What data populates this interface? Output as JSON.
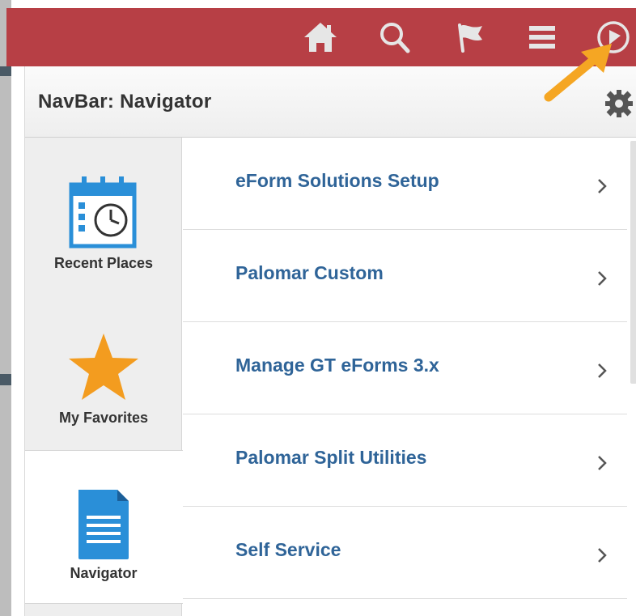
{
  "header": {
    "buttons": [
      {
        "name": "home-icon"
      },
      {
        "name": "search-icon"
      },
      {
        "name": "flag-icon"
      },
      {
        "name": "menu-icon"
      },
      {
        "name": "navbar-compass-icon"
      }
    ],
    "bar_color": "#b73f45"
  },
  "panel": {
    "title": "NavBar: Navigator",
    "settings_icon": "gear-icon"
  },
  "rail": {
    "items": [
      {
        "label": "Recent Places",
        "icon": "calendar-clock-icon",
        "active": false
      },
      {
        "label": "My Favorites",
        "icon": "star-icon",
        "active": false
      },
      {
        "label": "Navigator",
        "icon": "document-icon",
        "active": true
      }
    ]
  },
  "menu": {
    "items": [
      {
        "label": "eForm Solutions Setup"
      },
      {
        "label": "Palomar Custom"
      },
      {
        "label": "Manage GT eForms 3.x"
      },
      {
        "label": "Palomar Split Utilities"
      },
      {
        "label": "Self Service"
      }
    ],
    "chevron_icon": "chevron-right-icon"
  },
  "colors": {
    "accent_blue": "#2f6498",
    "icon_blue": "#2a8fd8",
    "star_orange": "#f39c1f",
    "annotation_arrow": "#f5a623"
  }
}
